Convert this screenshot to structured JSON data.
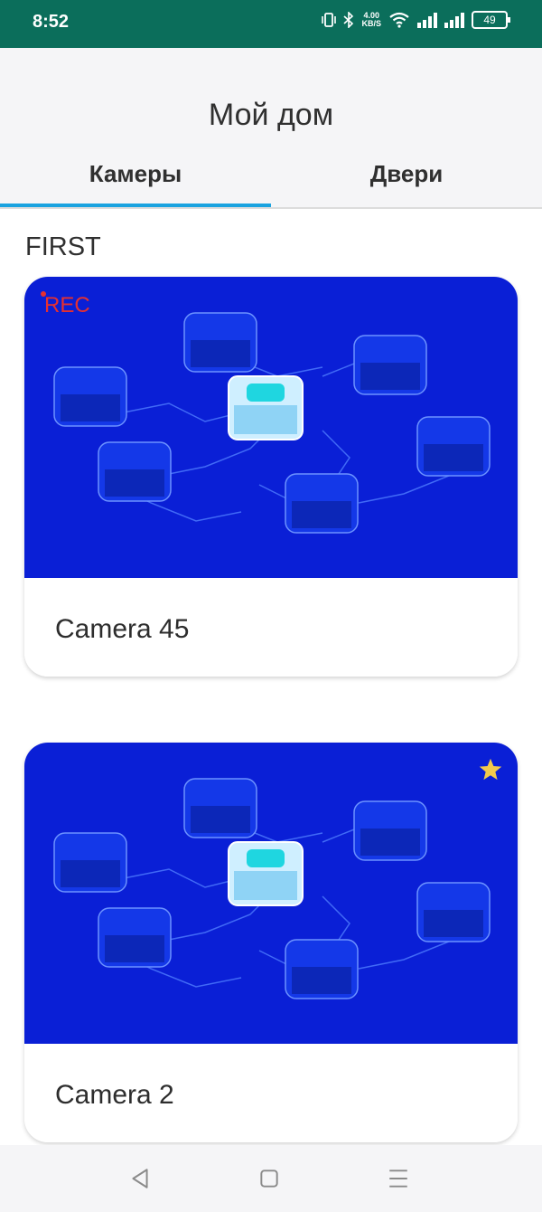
{
  "status_bar": {
    "time": "8:52",
    "net_speed_value": "4.00",
    "net_speed_unit": "KB/S",
    "battery": "49",
    "icons": [
      "vibrate-icon",
      "bluetooth-icon",
      "wifi-icon",
      "signal-icon",
      "signal-icon",
      "battery-icon"
    ]
  },
  "header": {
    "title": "Мой дом",
    "tabs": [
      {
        "label": "Камеры",
        "active": true
      },
      {
        "label": "Двери",
        "active": false
      }
    ],
    "accent_color": "#1aa3e0"
  },
  "content": {
    "section_title": "FIRST",
    "cameras": [
      {
        "name": "Camera 45",
        "badge": "REC",
        "favorite": false
      },
      {
        "name": "Camera 2",
        "badge": "",
        "favorite": true
      }
    ]
  },
  "colors": {
    "status_bar": "#0b6e5b",
    "card_image_bg": "#0a1fd6",
    "rec": "#e53030",
    "star": "#f2c94c"
  },
  "nav_bar": {
    "icons": [
      "back-icon",
      "home-icon",
      "menu-icon"
    ]
  }
}
